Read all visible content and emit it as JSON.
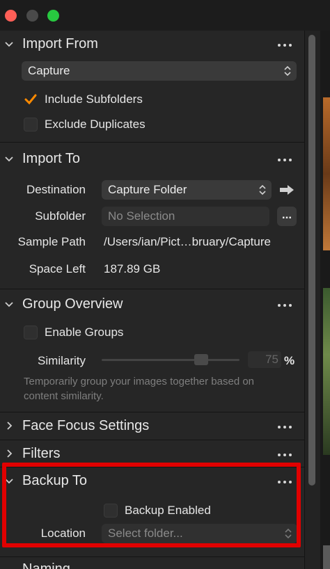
{
  "colors": {
    "accent_check": "#ff8a00",
    "highlight": "#e10000"
  },
  "import_from": {
    "title": "Import From",
    "source": "Capture",
    "include_subfolders": {
      "label": "Include Subfolders",
      "checked": true
    },
    "exclude_duplicates": {
      "label": "Exclude Duplicates",
      "checked": false
    }
  },
  "import_to": {
    "title": "Import To",
    "destination_label": "Destination",
    "destination_value": "Capture Folder",
    "subfolder_label": "Subfolder",
    "subfolder_placeholder": "No Selection",
    "subfolder_button": "...",
    "sample_path_label": "Sample Path",
    "sample_path_value": "/Users/ian/Pict…bruary/Capture",
    "space_left_label": "Space Left",
    "space_left_value": "187.89 GB"
  },
  "group_overview": {
    "title": "Group Overview",
    "enable_groups_label": "Enable Groups",
    "similarity_label": "Similarity",
    "similarity_value": "75",
    "similarity_fraction": 0.75,
    "percent": "%",
    "description": "Temporarily group your images together based on content similarity."
  },
  "face_focus": {
    "title": "Face Focus Settings"
  },
  "filters": {
    "title": "Filters"
  },
  "backup_to": {
    "title": "Backup To",
    "backup_enabled_label": "Backup Enabled",
    "location_label": "Location",
    "location_placeholder": "Select folder..."
  },
  "naming": {
    "title": "Naming"
  }
}
